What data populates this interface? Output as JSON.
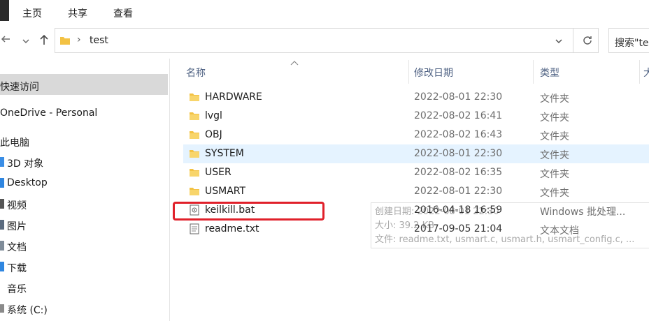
{
  "ribbon": {
    "tabs": [
      "主页",
      "共享",
      "查看"
    ]
  },
  "nav": {
    "back_icon": "back-arrow-icon",
    "dropdown_icon": "chevron-down-icon",
    "up_icon": "up-arrow-icon",
    "path_separator": "›",
    "path": "test",
    "search_placeholder": "搜索\"test\""
  },
  "sidebar": {
    "items": [
      {
        "label": "快速访问",
        "icon": "star-icon"
      },
      {
        "label": "OneDrive - Personal",
        "icon": "cloud-icon"
      },
      {
        "label": "此电脑",
        "icon": "computer-icon"
      },
      {
        "label": "3D 对象",
        "icon": "cube-icon"
      },
      {
        "label": "Desktop",
        "icon": "desktop-icon"
      },
      {
        "label": "视频",
        "icon": "video-icon"
      },
      {
        "label": "图片",
        "icon": "picture-icon"
      },
      {
        "label": "文档",
        "icon": "document-icon"
      },
      {
        "label": "下载",
        "icon": "download-icon"
      },
      {
        "label": "音乐",
        "icon": "music-icon"
      },
      {
        "label": "系统 (C:)",
        "icon": "drive-icon"
      }
    ]
  },
  "columns": {
    "name": "名称",
    "date": "修改日期",
    "type": "类型",
    "size": "大"
  },
  "files": [
    {
      "name": "HARDWARE",
      "date": "2022-08-01 22:30",
      "type": "文件夹",
      "icon": "folder-icon"
    },
    {
      "name": "lvgl",
      "date": "2022-08-02 16:41",
      "type": "文件夹",
      "icon": "folder-icon"
    },
    {
      "name": "OBJ",
      "date": "2022-08-02 16:43",
      "type": "文件夹",
      "icon": "folder-icon"
    },
    {
      "name": "SYSTEM",
      "date": "2022-08-01 22:30",
      "type": "文件夹",
      "icon": "folder-icon"
    },
    {
      "name": "USER",
      "date": "2022-08-02 16:35",
      "type": "文件夹",
      "icon": "folder-icon"
    },
    {
      "name": "USMART",
      "date": "2022-08-01 22:30",
      "type": "文件夹",
      "icon": "folder-icon"
    },
    {
      "name": "keilkill.bat",
      "date": "2016-04-18 16:59",
      "type": "Windows 批处理...",
      "icon": "batch-file-icon"
    },
    {
      "name": "readme.txt",
      "date": "2017-09-05 21:04",
      "type": "文本文档",
      "icon": "text-file-icon"
    }
  ],
  "tooltip": {
    "line1": "创建日期: 2022-08-01 22:30",
    "line2": "大小: 39.2 KB",
    "line3": "文件: readme.txt, usmart.c, usmart.h, usmart_config.c, ..."
  },
  "colors": {
    "selected_row": "#e5f3ff",
    "highlight": "#e0202a",
    "folder": "#f3c244"
  }
}
